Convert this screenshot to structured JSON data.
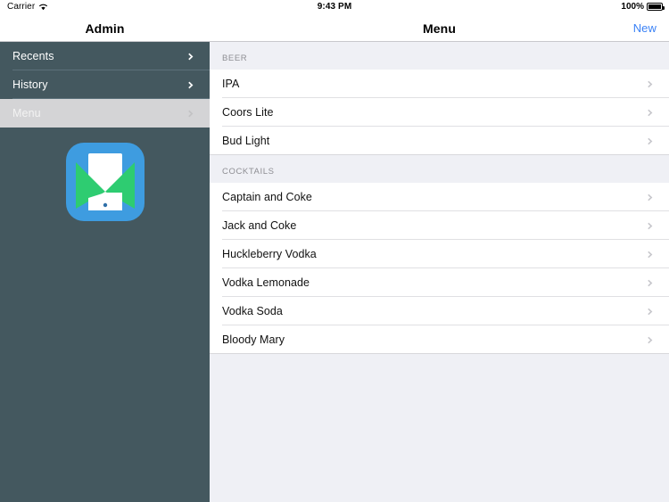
{
  "status_bar": {
    "carrier": "Carrier",
    "wifi_icon": "wifi-icon",
    "time": "9:43 PM",
    "battery_percent": "100%",
    "battery_icon": "battery-full-icon"
  },
  "sidebar": {
    "title": "Admin",
    "items": [
      {
        "label": "Recents",
        "selected": false,
        "chevron": "chevron-right-icon"
      },
      {
        "label": "History",
        "selected": false,
        "chevron": "chevron-right-icon"
      },
      {
        "label": "Menu",
        "selected": true,
        "chevron": "chevron-right-icon"
      }
    ],
    "logo": {
      "name": "app-logo",
      "background_color": "#3e9ce0",
      "accent_color": "#2ecc71",
      "device_color": "#ffffff"
    },
    "background_color": "#44585f",
    "selected_background_color": "#d4d4d6"
  },
  "detail": {
    "title": "Menu",
    "new_label": "New",
    "accent_color": "#3b82f6",
    "sections": [
      {
        "header": "BEER",
        "items": [
          {
            "label": "IPA",
            "chevron": "chevron-right-icon"
          },
          {
            "label": "Coors Lite",
            "chevron": "chevron-right-icon"
          },
          {
            "label": "Bud Light",
            "chevron": "chevron-right-icon"
          }
        ]
      },
      {
        "header": "COCKTAILS",
        "items": [
          {
            "label": "Captain and Coke",
            "chevron": "chevron-right-icon"
          },
          {
            "label": "Jack and Coke",
            "chevron": "chevron-right-icon"
          },
          {
            "label": "Huckleberry Vodka",
            "chevron": "chevron-right-icon"
          },
          {
            "label": "Vodka Lemonade",
            "chevron": "chevron-right-icon"
          },
          {
            "label": "Vodka Soda",
            "chevron": "chevron-right-icon"
          },
          {
            "label": "Bloody Mary",
            "chevron": "chevron-right-icon"
          }
        ]
      }
    ]
  }
}
